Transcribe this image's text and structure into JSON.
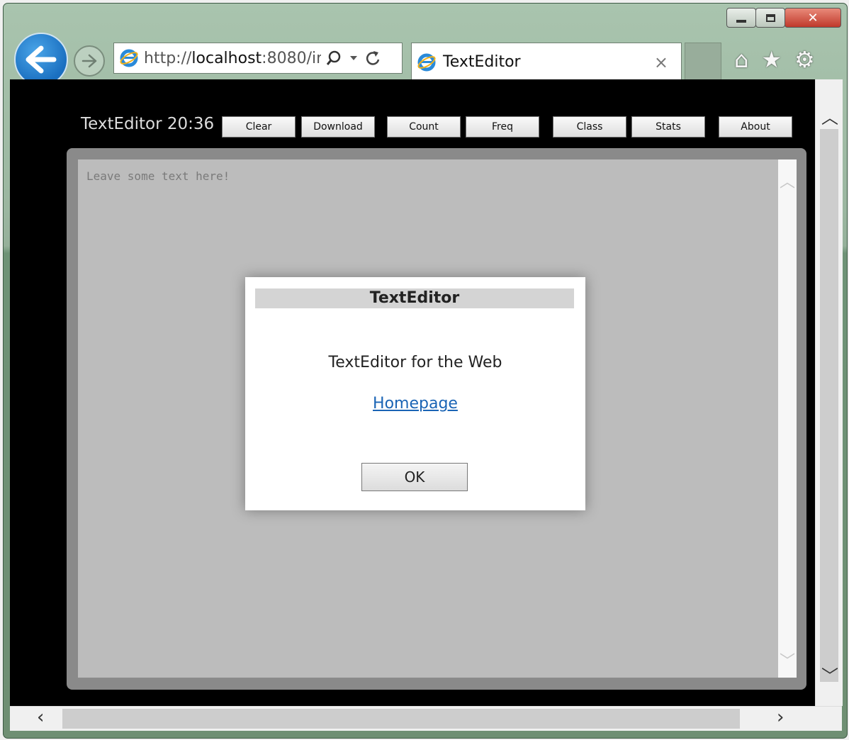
{
  "browser": {
    "address": "http://localhost:8080/in",
    "address_host": "localhost",
    "tab_title": "TextEditor",
    "close_glyph": "×",
    "icons": [
      "back-icon",
      "forward-icon",
      "ie-logo-icon",
      "search-icon",
      "dropdown-icon",
      "refresh-icon",
      "home-icon",
      "favorites-icon",
      "settings-icon"
    ]
  },
  "app": {
    "title": "TextEditor 20:36",
    "buttons": {
      "clear": "Clear",
      "download": "Download",
      "count": "Count",
      "freq": "Freq",
      "class": "Class",
      "stats": "Stats",
      "about": "About"
    },
    "editor_placeholder": "Leave some text here!"
  },
  "dialog": {
    "title": "TextEditor",
    "message": "TextEditor for the Web",
    "link": "Homepage",
    "ok": "OK"
  }
}
